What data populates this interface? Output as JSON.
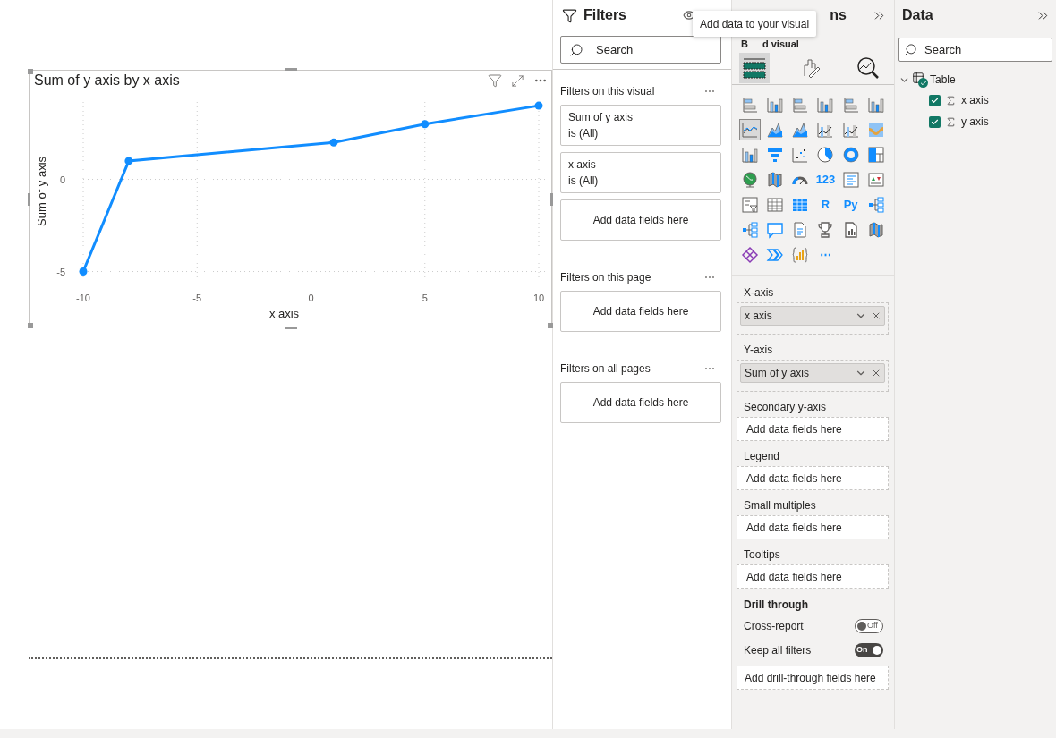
{
  "visual": {
    "title": "Sum of y axis by x axis",
    "chart_data": {
      "type": "line",
      "xlabel": "x axis",
      "ylabel": "Sum of y axis",
      "x": [
        -10,
        -8,
        1,
        5,
        10
      ],
      "grid": true,
      "series": [
        {
          "color": "#118dff",
          "marker": true,
          "values": [
            -5,
            1,
            2,
            3,
            4
          ]
        }
      ],
      "xlim": [
        -10,
        10
      ],
      "ylim": [
        -5.5,
        4.2
      ],
      "xticks": [
        -10,
        -5,
        0,
        5,
        10
      ],
      "yticks": [
        -5,
        0
      ]
    }
  },
  "filters": {
    "title": "Filters",
    "search": {
      "placeholder": "Search"
    },
    "sections": [
      {
        "title": "Filters on this visual",
        "more": "⋯",
        "cards": [
          {
            "kind": "filter",
            "field": "Sum of y axis",
            "state": "is (All)"
          },
          {
            "kind": "filter",
            "field": "x axis",
            "state": "is (All)"
          },
          {
            "kind": "drop",
            "text": "Add data fields here"
          }
        ]
      },
      {
        "title": "Filters on this page",
        "more": "⋯",
        "cards": [
          {
            "kind": "drop",
            "text": "Add data fields here"
          }
        ]
      },
      {
        "title": "Filters on all pages",
        "more": "⋯",
        "cards": [
          {
            "kind": "drop",
            "text": "Add data fields here"
          }
        ]
      }
    ]
  },
  "visualizations": {
    "title_visible": "ns",
    "build_label_parts": [
      "B",
      "d visual"
    ],
    "tooltip": "Add data to your visual",
    "tabs": [
      {
        "kind": "fields",
        "selected": true
      },
      {
        "kind": "format",
        "selected": false
      },
      {
        "kind": "analytics",
        "selected": false
      }
    ],
    "visual_types": [
      {
        "kind": "bar-h",
        "selected": false
      },
      {
        "kind": "bar-v",
        "selected": false
      },
      {
        "kind": "bar-h",
        "selected": false
      },
      {
        "kind": "bar-v",
        "selected": false
      },
      {
        "kind": "bar-h",
        "selected": false
      },
      {
        "kind": "bar-v",
        "selected": false
      },
      {
        "kind": "line",
        "selected": true
      },
      {
        "kind": "area",
        "selected": false
      },
      {
        "kind": "area",
        "selected": false
      },
      {
        "kind": "combo",
        "selected": false
      },
      {
        "kind": "combo",
        "selected": false
      },
      {
        "kind": "ribbon",
        "selected": false
      },
      {
        "kind": "bar-v",
        "selected": false
      },
      {
        "kind": "funnel",
        "selected": false
      },
      {
        "kind": "scatter",
        "selected": false
      },
      {
        "kind": "pie",
        "selected": false
      },
      {
        "kind": "donut",
        "selected": false
      },
      {
        "kind": "treemap",
        "selected": false
      },
      {
        "kind": "globe",
        "selected": false
      },
      {
        "kind": "map",
        "selected": false
      },
      {
        "kind": "gauge",
        "selected": false
      },
      {
        "kind": "glyph",
        "glyph": "123",
        "selected": false
      },
      {
        "kind": "text-lines",
        "selected": false
      },
      {
        "kind": "kpi",
        "selected": false
      },
      {
        "kind": "slicer",
        "selected": false
      },
      {
        "kind": "table",
        "selected": false
      },
      {
        "kind": "matrix",
        "selected": false
      },
      {
        "kind": "glyph",
        "glyph": "R",
        "selected": false
      },
      {
        "kind": "glyph",
        "glyph": "Py",
        "selected": false
      },
      {
        "kind": "tree",
        "selected": false
      },
      {
        "kind": "tree",
        "selected": false
      },
      {
        "kind": "speech",
        "selected": false
      },
      {
        "kind": "document",
        "selected": false
      },
      {
        "kind": "trophy",
        "selected": false
      },
      {
        "kind": "report",
        "selected": false
      },
      {
        "kind": "map",
        "selected": false
      },
      {
        "kind": "diamond",
        "selected": false
      },
      {
        "kind": "chevrons",
        "selected": false
      },
      {
        "kind": "braces",
        "selected": false
      },
      {
        "kind": "glyph",
        "glyph": "⋯",
        "selected": false
      }
    ],
    "wells": [
      {
        "label": "X-axis",
        "kind": "field",
        "field": "x axis"
      },
      {
        "label": "Y-axis",
        "kind": "field",
        "field": "Sum of y axis"
      },
      {
        "label": "Secondary y-axis",
        "kind": "empty",
        "text": "Add data fields here"
      },
      {
        "label": "Legend",
        "kind": "empty",
        "text": "Add data fields here"
      },
      {
        "label": "Small multiples",
        "kind": "empty",
        "text": "Add data fields here"
      },
      {
        "label": "Tooltips",
        "kind": "empty",
        "text": "Add data fields here"
      }
    ],
    "drill_through": {
      "title": "Drill through",
      "toggles": [
        {
          "label": "Cross-report",
          "on": false,
          "text": "Off"
        },
        {
          "label": "Keep all filters",
          "on": true,
          "text": "On"
        }
      ],
      "well": "Add drill-through fields here"
    }
  },
  "data": {
    "title": "Data",
    "search": {
      "placeholder": "Search"
    },
    "tree": [
      {
        "label": "Table",
        "expanded": true,
        "children": [
          {
            "label": "x axis",
            "checked": true
          },
          {
            "label": "y axis",
            "checked": true
          }
        ]
      }
    ]
  }
}
